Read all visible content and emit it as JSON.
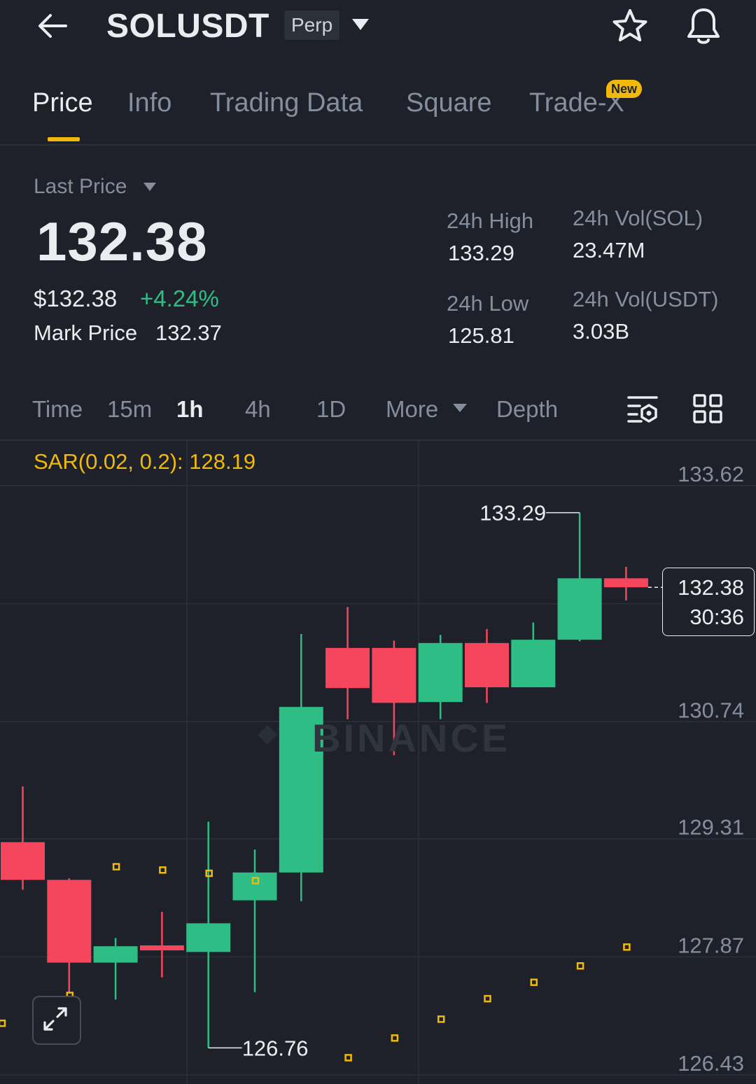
{
  "header": {
    "symbol": "SOLUSDT",
    "contract_type": "Perp"
  },
  "tabs": {
    "items": [
      {
        "label": "Price",
        "active": true
      },
      {
        "label": "Info"
      },
      {
        "label": "Trading Data"
      },
      {
        "label": "Square"
      },
      {
        "label": "Trade-X"
      }
    ],
    "new_badge": "New"
  },
  "price": {
    "selector_label": "Last Price",
    "last_price": "132.38",
    "usd_price": "$132.38",
    "change_pct": "+4.24%",
    "mark_price_label": "Mark Price",
    "mark_price": "132.37"
  },
  "stats": {
    "high_label": "24h High",
    "high_value": "133.29",
    "low_label": "24h Low",
    "low_value": "125.81",
    "vol_base_label": "24h Vol(SOL)",
    "vol_base_value": "23.47M",
    "vol_quote_label": "24h Vol(USDT)",
    "vol_quote_value": "3.03B"
  },
  "intervals": {
    "time": "Time",
    "m15": "15m",
    "h1": "1h",
    "h4": "4h",
    "d1": "1D",
    "more": "More",
    "depth": "Depth",
    "active": "1h"
  },
  "indicator": {
    "label": "SAR(0.02, 0.2): 128.19"
  },
  "chart": {
    "watermark": "BINANCE",
    "last_price_box": "132.38",
    "countdown": "30:36",
    "high_marker": "133.29",
    "low_marker": "126.76"
  },
  "colors": {
    "up": "#2ebd85",
    "down": "#f6465d",
    "accent": "#f0b90b",
    "background": "#1e2129"
  },
  "chart_data": {
    "type": "candlestick",
    "interval": "1h",
    "y_ticks": [
      133.62,
      130.74,
      129.31,
      127.87,
      126.43
    ],
    "ylim": [
      126.33,
      134.14
    ],
    "candles": [
      {
        "o": 129.27,
        "h": 129.95,
        "l": 128.69,
        "c": 128.81
      },
      {
        "o": 128.81,
        "h": 128.83,
        "l": 127.44,
        "c": 127.8
      },
      {
        "o": 127.8,
        "h": 128.1,
        "l": 127.35,
        "c": 128.0
      },
      {
        "o": 128.01,
        "h": 128.42,
        "l": 127.62,
        "c": 127.95
      },
      {
        "o": 127.93,
        "h": 129.52,
        "l": 126.76,
        "c": 128.28
      },
      {
        "o": 128.56,
        "h": 129.18,
        "l": 127.44,
        "c": 128.9
      },
      {
        "o": 128.9,
        "h": 131.81,
        "l": 128.55,
        "c": 130.92
      },
      {
        "o": 131.64,
        "h": 132.14,
        "l": 130.77,
        "c": 131.15
      },
      {
        "o": 131.64,
        "h": 131.73,
        "l": 130.33,
        "c": 130.97
      },
      {
        "o": 130.98,
        "h": 131.8,
        "l": 130.77,
        "c": 131.7
      },
      {
        "o": 131.7,
        "h": 131.87,
        "l": 130.97,
        "c": 131.16
      },
      {
        "o": 131.16,
        "h": 131.95,
        "l": 131.16,
        "c": 131.74
      },
      {
        "o": 131.74,
        "h": 133.29,
        "l": 131.72,
        "c": 132.49
      },
      {
        "o": 132.49,
        "h": 132.63,
        "l": 132.22,
        "c": 132.38
      }
    ],
    "sar": [
      null,
      127.4,
      128.97,
      128.93,
      128.89,
      128.8,
      null,
      126.64,
      126.88,
      127.11,
      127.36,
      127.56,
      127.76,
      127.99
    ],
    "sar_pre": 127.06,
    "last_price": 132.38
  }
}
